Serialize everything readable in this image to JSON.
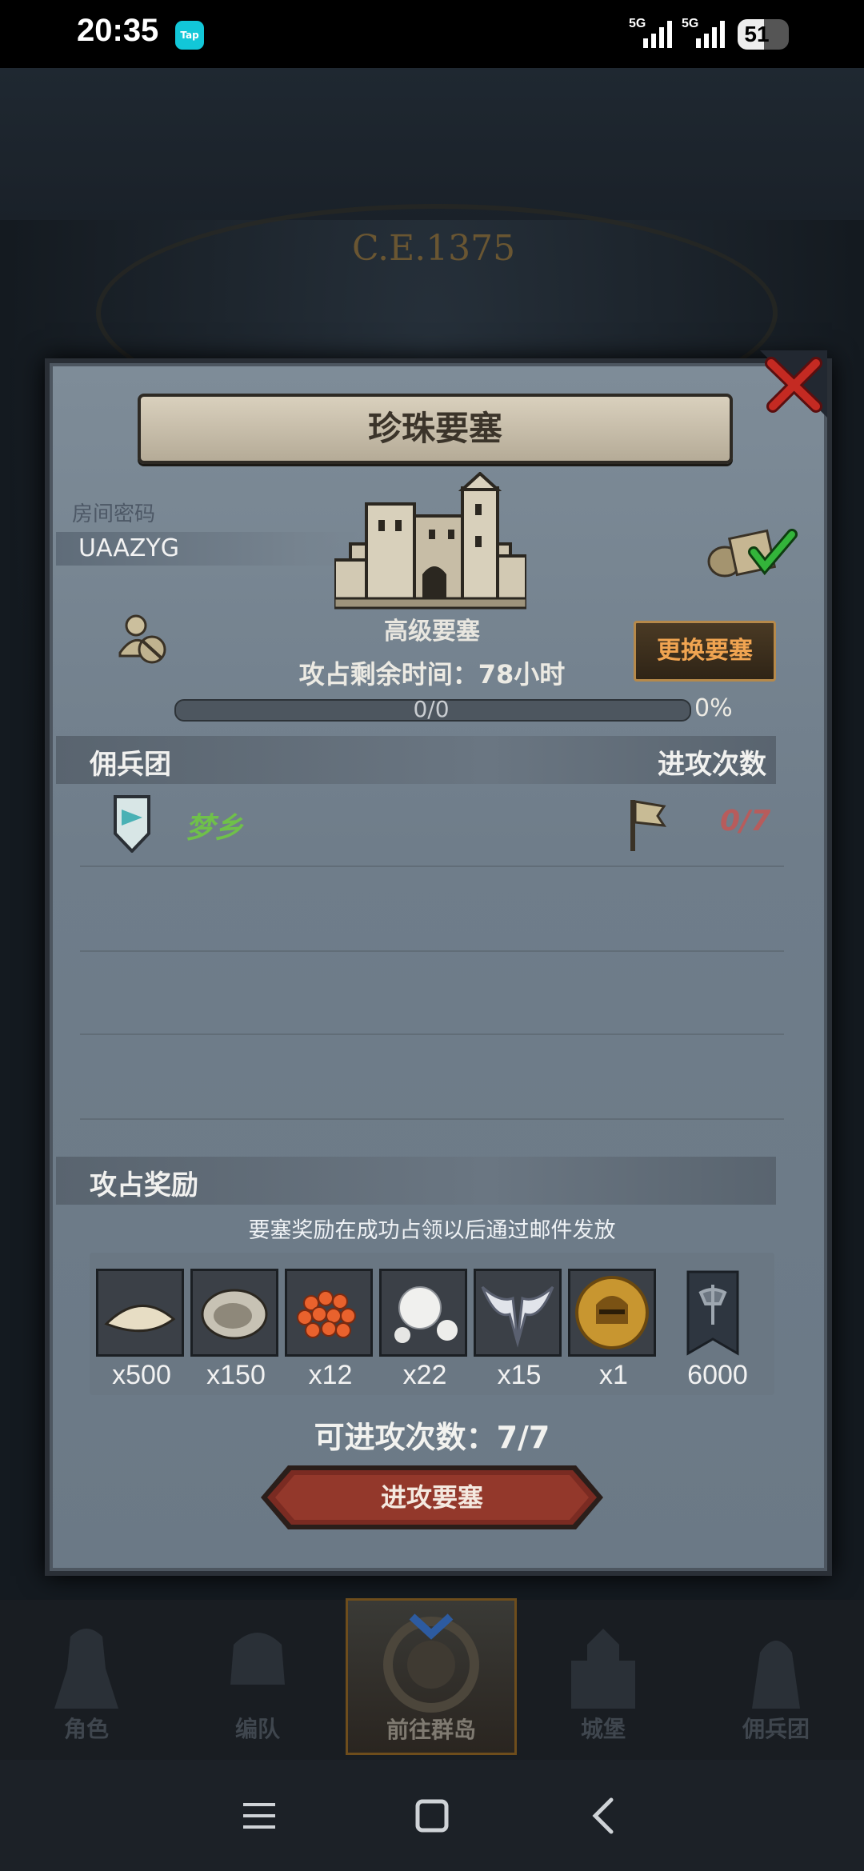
{
  "status_bar": {
    "time": "20:35",
    "tap_badge": "Tap",
    "signal_labels": [
      "5G",
      "5G"
    ],
    "battery": "51"
  },
  "background": {
    "era_title": "C.E.1375"
  },
  "dialog": {
    "title": "珍珠要塞",
    "room_label": "房间密码",
    "room_code": "UAAZYG",
    "fortress_type": "高级要塞",
    "time_left": "攻占剩余时间：78小时",
    "change_button": "更换要塞",
    "progress_text": "0/0",
    "progress_percent": "0%",
    "progress_fraction": 0,
    "mercenary_header": "佣兵团",
    "attacks_header": "进攻次数",
    "mercenary": {
      "name": "梦乡",
      "attacks": "0/7"
    },
    "rewards_header": "攻占奖励",
    "reward_note": "要塞奖励在成功占领以后通过邮件发放",
    "rewards": [
      {
        "icon": "flour-sack-icon",
        "qty": "x500"
      },
      {
        "icon": "oyster-icon",
        "qty": "x150"
      },
      {
        "icon": "fish-roe-icon",
        "qty": "x12"
      },
      {
        "icon": "pearl-icon",
        "qty": "x22"
      },
      {
        "icon": "winged-emblem-icon",
        "qty": "x15"
      },
      {
        "icon": "knight-medal-icon",
        "qty": "x1"
      },
      {
        "icon": "guild-banner-icon",
        "qty": "6000"
      }
    ],
    "available_attacks": "可进攻次数：7/7",
    "attack_button": "进攻要塞"
  },
  "bottom_nav": {
    "items": [
      {
        "label": "角色"
      },
      {
        "label": "编队"
      },
      {
        "label": "前往群岛",
        "active": true
      },
      {
        "label": "城堡"
      },
      {
        "label": "佣兵团"
      }
    ]
  },
  "colors": {
    "accent_orange": "#f0a451",
    "mercenary_green": "#6fc04a",
    "attack_count_red": "#b75c5c"
  }
}
